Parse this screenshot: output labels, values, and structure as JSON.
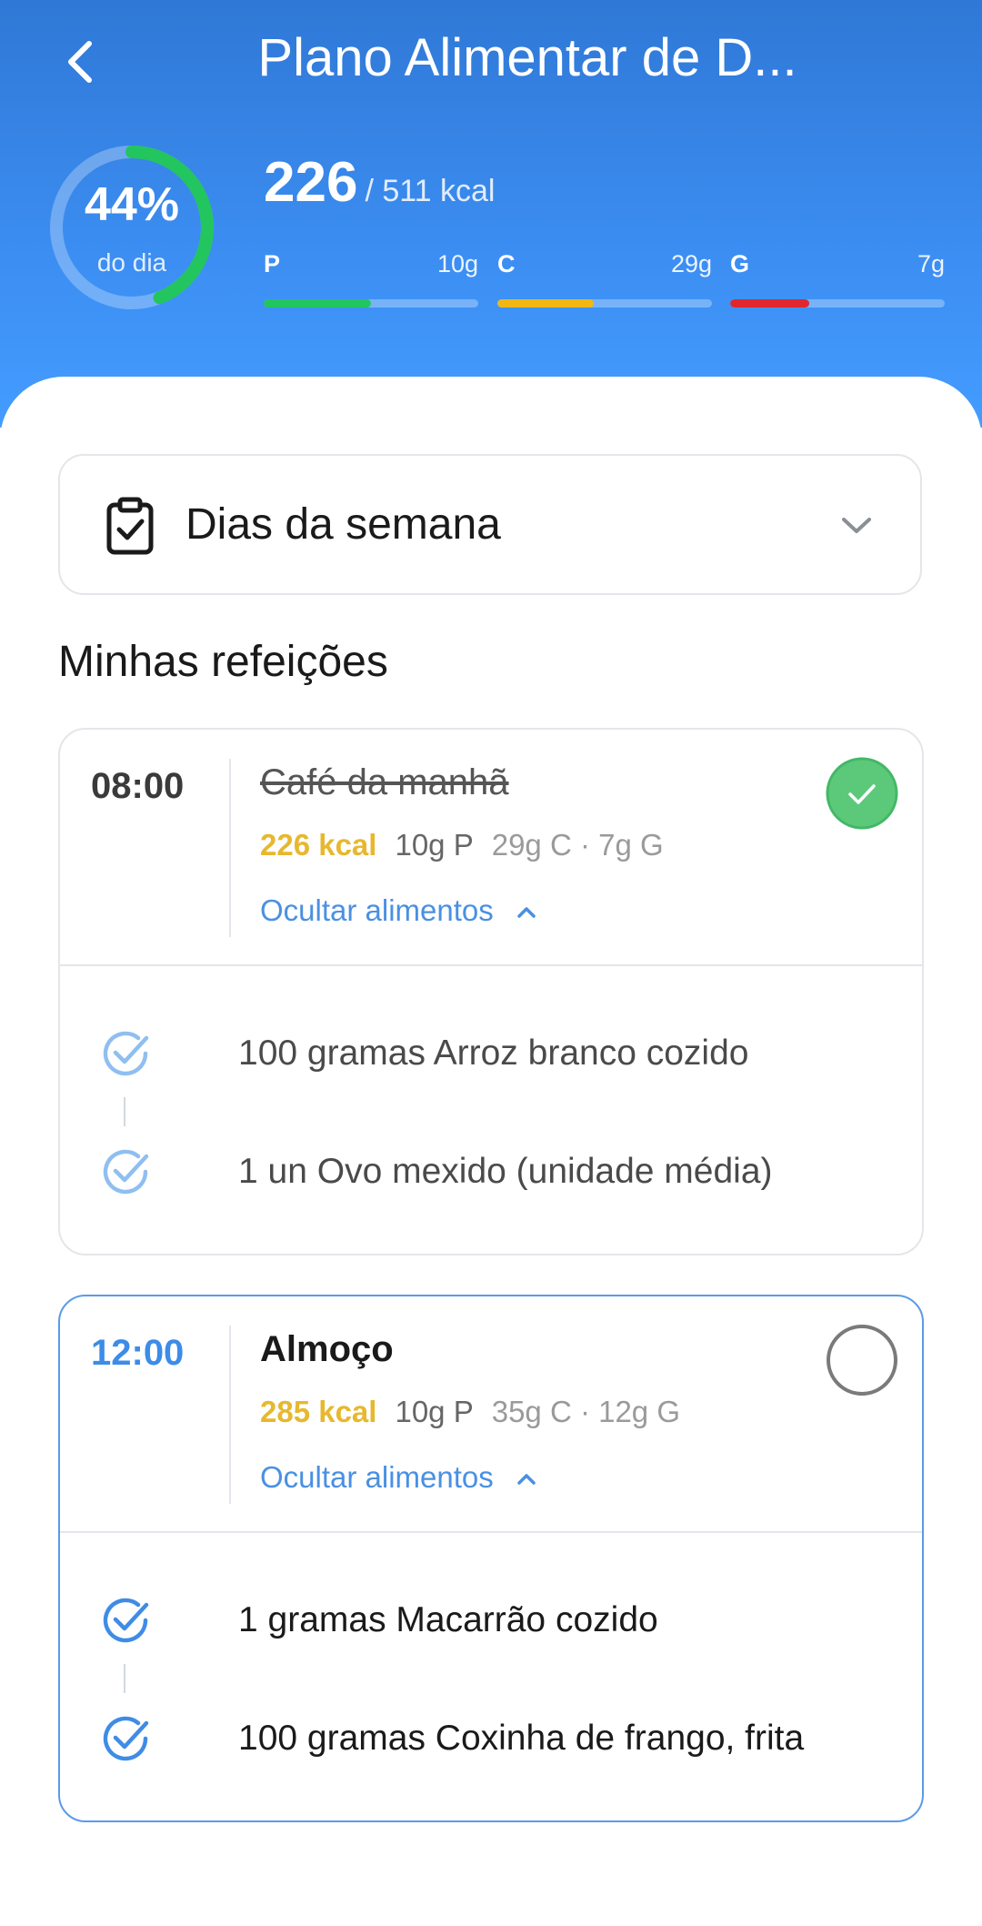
{
  "header": {
    "title": "Plano Alimentar de D...",
    "progress_percent_label": "44%",
    "progress_fraction": 0.44,
    "progress_sublabel": "do dia",
    "kcal_current": "226",
    "kcal_total": "/ 511 kcal",
    "macros": [
      {
        "label": "P",
        "value": "10g",
        "fill_fraction": 0.5,
        "color": "#22c55e"
      },
      {
        "label": "C",
        "value": "29g",
        "fill_fraction": 0.45,
        "color": "#f1b814"
      },
      {
        "label": "G",
        "value": "7g",
        "fill_fraction": 0.37,
        "color": "#e0272f"
      }
    ],
    "colors": {
      "ring_progress": "#22c55e",
      "gradient_top": "#2f78d6",
      "gradient_bottom": "#449cff"
    }
  },
  "week_dropdown": {
    "label": "Dias da semana",
    "icon": "clipboard-check-icon"
  },
  "section_title": "Minhas refeições",
  "meals": [
    {
      "time": "08:00",
      "name": "Café da manhã",
      "completed": true,
      "kcal": "226 kcal",
      "protein": "10g P",
      "carbs_fat": "29g C · 7g G",
      "toggle_label": "Ocultar alimentos",
      "foods": [
        "100 gramas Arroz branco cozido",
        "1 un Ovo mexido (unidade média)"
      ]
    },
    {
      "time": "12:00",
      "name": "Almoço",
      "completed": false,
      "kcal": "285 kcal",
      "protein": "10g P",
      "carbs_fat": "35g C · 12g G",
      "toggle_label": "Ocultar alimentos",
      "foods": [
        "1 gramas Macarrão cozido",
        "100 gramas Coxinha de frango, frita"
      ]
    }
  ],
  "colors": {
    "accent": "#4a90e2",
    "kcal": "#e7b82f",
    "done_green": "#5cc97a"
  }
}
